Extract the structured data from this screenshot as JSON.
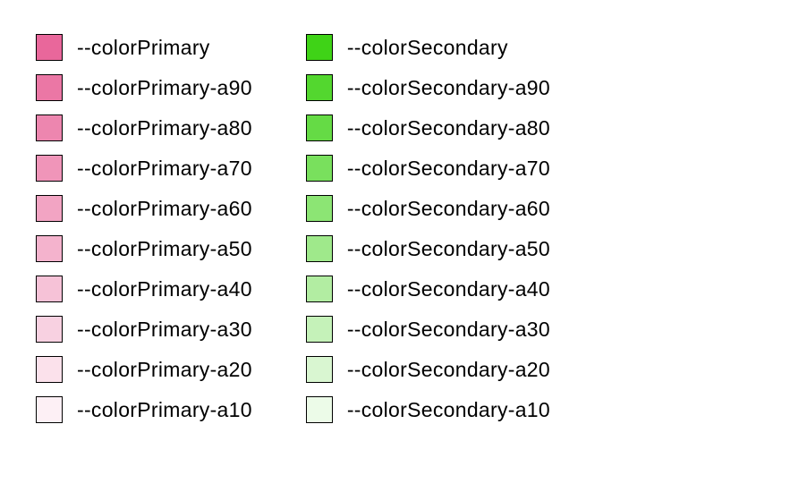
{
  "columns": [
    {
      "name": "primary-column",
      "items": [
        {
          "label": "--colorPrimary",
          "color": "#e9679b"
        },
        {
          "label": "--colorPrimary-a90",
          "color": "#eb77a5"
        },
        {
          "label": "--colorPrimary-a80",
          "color": "#ed86af"
        },
        {
          "label": "--colorPrimary-a70",
          "color": "#f095b9"
        },
        {
          "label": "--colorPrimary-a60",
          "color": "#f2a4c3"
        },
        {
          "label": "--colorPrimary-a50",
          "color": "#f4b3cd"
        },
        {
          "label": "--colorPrimary-a40",
          "color": "#f6c2d7"
        },
        {
          "label": "--colorPrimary-a30",
          "color": "#f8d1e1"
        },
        {
          "label": "--colorPrimary-a20",
          "color": "#fbe1eb"
        },
        {
          "label": "--colorPrimary-a10",
          "color": "#fdf0f5"
        }
      ]
    },
    {
      "name": "secondary-column",
      "items": [
        {
          "label": "--colorSecondary",
          "color": "#3fd317"
        },
        {
          "label": "--colorSecondary-a90",
          "color": "#53d72f"
        },
        {
          "label": "--colorSecondary-a80",
          "color": "#65db45"
        },
        {
          "label": "--colorSecondary-a70",
          "color": "#79e05d"
        },
        {
          "label": "--colorSecondary-a60",
          "color": "#8ce574"
        },
        {
          "label": "--colorSecondary-a50",
          "color": "#9fe98b"
        },
        {
          "label": "--colorSecondary-a40",
          "color": "#b2eda2"
        },
        {
          "label": "--colorSecondary-a30",
          "color": "#c5f2b9"
        },
        {
          "label": "--colorSecondary-a20",
          "color": "#d9f6d1"
        },
        {
          "label": "--colorSecondary-a10",
          "color": "#ecfbe8"
        }
      ]
    }
  ]
}
